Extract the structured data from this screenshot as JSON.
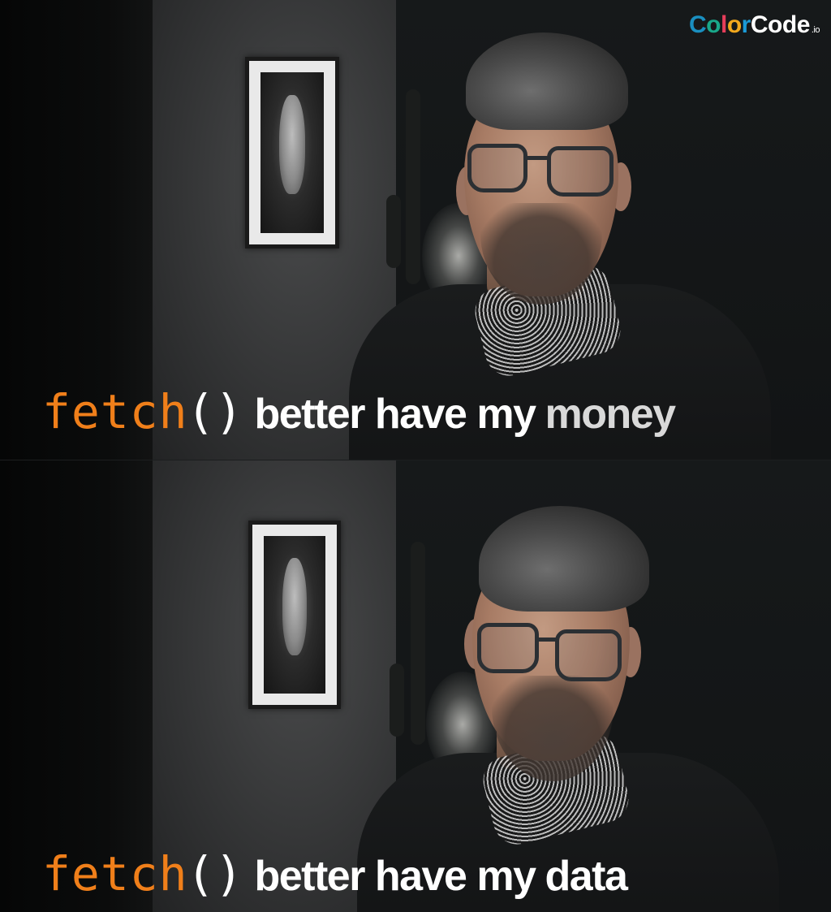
{
  "logo": {
    "text": "ColorCode",
    "suffix": ".io",
    "letter_colors": [
      "#1a8fc0",
      "#19a88a",
      "#e63d5a",
      "#f2a81d",
      "#1b9bd7",
      "#ffffff",
      "#ffffff",
      "#ffffff",
      "#ffffff"
    ]
  },
  "panels": [
    {
      "caption": {
        "function_name": "fetch",
        "parens": "()",
        "words": "better have my",
        "last_word": "money"
      }
    },
    {
      "caption": {
        "function_name": "fetch",
        "parens": "()",
        "words": "better have my",
        "last_word": "data"
      }
    }
  ],
  "colors": {
    "function_orange": "#f07f1a",
    "caption_white": "#ffffff",
    "last_word_top": "#d9d9d9"
  }
}
